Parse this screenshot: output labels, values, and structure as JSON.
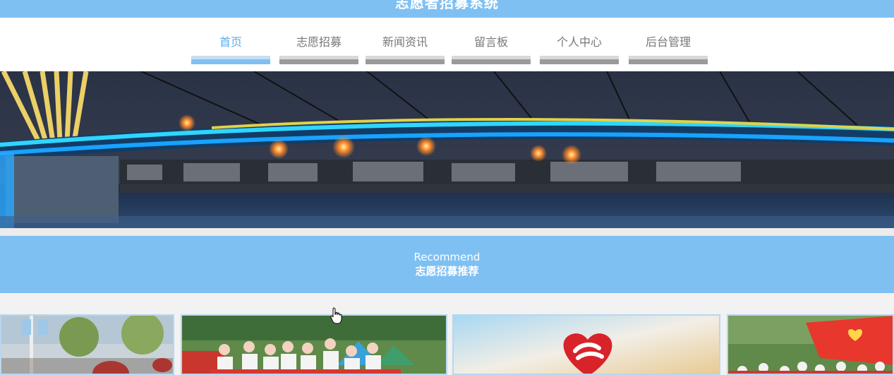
{
  "header": {
    "site_title": "志愿者招募系统"
  },
  "nav": {
    "items": [
      {
        "label": "首页",
        "active": true
      },
      {
        "label": "志愿招募",
        "active": false
      },
      {
        "label": "新闻资讯",
        "active": false
      },
      {
        "label": "留言板",
        "active": false
      },
      {
        "label": "个人中心",
        "active": false
      },
      {
        "label": "后台管理",
        "active": false
      }
    ]
  },
  "recommend": {
    "title_en": "Recommend",
    "title_zh": "志愿招募推荐"
  },
  "colors": {
    "accent": "#7fc0f2",
    "nav_inactive_bar": "#9a9a9a",
    "nav_active_text": "#5aaee8"
  },
  "icons": {
    "cursor": "hand-pointer-icon",
    "card3_logo": "volunteer-heart-hand-icon"
  }
}
